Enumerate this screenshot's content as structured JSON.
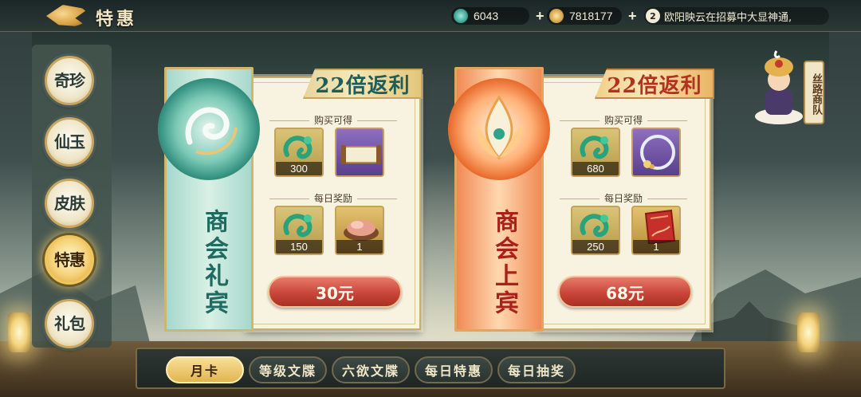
{
  "header": {
    "title": "特惠",
    "resources": [
      {
        "name": "jade",
        "value": "6043",
        "icon": "jade-currency-icon",
        "color": "#3cb5a8"
      },
      {
        "name": "coin",
        "value": "7818177",
        "icon": "coin-currency-icon",
        "color": "#d7a54a"
      }
    ],
    "ticker": {
      "badge": "2",
      "text": "欧阳映云在招募中大显神通,"
    }
  },
  "sidebar": {
    "items": [
      {
        "label": "奇珍",
        "active": false
      },
      {
        "label": "仙玉",
        "active": false
      },
      {
        "label": "皮肤",
        "active": false
      },
      {
        "label": "特惠",
        "active": true
      },
      {
        "label": "礼包",
        "active": false
      }
    ]
  },
  "cards": [
    {
      "name": "商会礼宾",
      "theme": "teal",
      "bonus": "22倍返利",
      "purchase_label": "购买可得",
      "purchase_items": [
        {
          "icon": "jade-dragon-icon",
          "count": "300"
        },
        {
          "icon": "scroll-icon",
          "count": ""
        }
      ],
      "daily_label": "每日奖励",
      "daily_items": [
        {
          "icon": "jade-dragon-icon",
          "count": "150"
        },
        {
          "icon": "food-bowl-icon",
          "count": "1"
        }
      ],
      "price": "30元"
    },
    {
      "name": "商会上宾",
      "theme": "orange",
      "bonus": "22倍返利",
      "purchase_label": "购买可得",
      "purchase_items": [
        {
          "icon": "jade-dragon-icon",
          "count": "680"
        },
        {
          "icon": "jade-ring-icon",
          "count": ""
        }
      ],
      "daily_label": "每日奖励",
      "daily_items": [
        {
          "icon": "jade-dragon-icon",
          "count": "250"
        },
        {
          "icon": "red-ticket-icon",
          "count": "1"
        }
      ],
      "price": "68元"
    }
  ],
  "merchant": {
    "label": "丝路商队"
  },
  "tabs": [
    {
      "label": "月卡",
      "active": true
    },
    {
      "label": "等级文牒",
      "active": false
    },
    {
      "label": "六欲文牒",
      "active": false
    },
    {
      "label": "每日特惠",
      "active": false
    },
    {
      "label": "每日抽奖",
      "active": false
    }
  ]
}
